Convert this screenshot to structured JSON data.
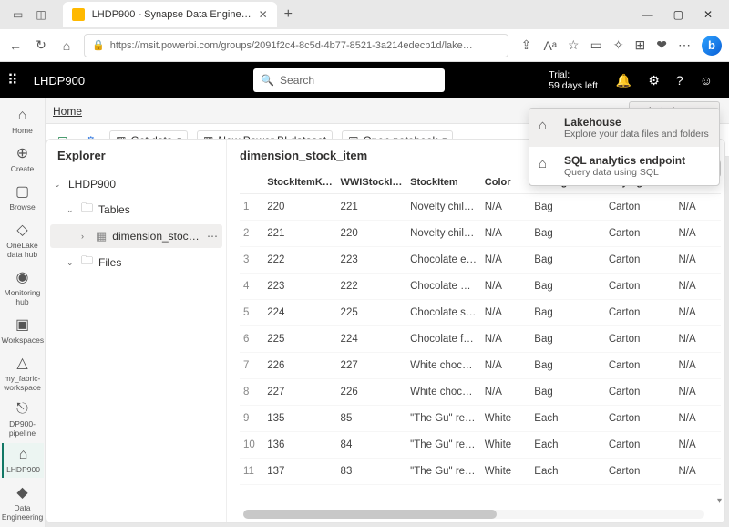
{
  "browser": {
    "tab_title": "LHDP900 - Synapse Data Engine…",
    "url": "https://msit.powerbi.com/groups/2091f2c4-8c5d-4b77-8521-3a214edecb1d/lake…"
  },
  "app": {
    "title": "LHDP900",
    "search_placeholder": "Search",
    "trial_label": "Trial:",
    "trial_days": "59 days left"
  },
  "breadcrumb": {
    "home": "Home"
  },
  "lakehouse_dropdown": {
    "label": "Lakehouse",
    "options": [
      {
        "title": "Lakehouse",
        "desc": "Explore your data files and folders"
      },
      {
        "title": "SQL analytics endpoint",
        "desc": "Query data using SQL"
      }
    ]
  },
  "toolbar": {
    "get_data": "Get data",
    "new_pbi": "New Power BI dataset",
    "open_notebook": "Open notebook"
  },
  "leftrail": [
    {
      "icon": "⌂",
      "label": "Home"
    },
    {
      "icon": "⊕",
      "label": "Create"
    },
    {
      "icon": "▢",
      "label": "Browse"
    },
    {
      "icon": "◇",
      "label": "OneLake data hub"
    },
    {
      "icon": "◉",
      "label": "Monitoring hub"
    },
    {
      "icon": "▣",
      "label": "Workspaces"
    },
    {
      "icon": "△",
      "label": "my_fabric-workspace"
    },
    {
      "icon": "⎋",
      "label": "DP900-pipeline"
    },
    {
      "icon": "⌂",
      "label": "LHDP900"
    },
    {
      "icon": "◆",
      "label": "Data Engineering"
    }
  ],
  "explorer": {
    "title": "Explorer",
    "root": "LHDP900",
    "tables": "Tables",
    "table_item": "dimension_stock_it…",
    "files": "Files"
  },
  "table": {
    "title": "dimension_stock_item",
    "columns": [
      "",
      "StockItemK…",
      "WWIStockI…",
      "StockItem",
      "Color",
      "SellingPack…",
      "BuyingPac…",
      "Brand"
    ],
    "rows": [
      [
        "1",
        "220",
        "221",
        "Novelty chil…",
        "N/A",
        "Bag",
        "Carton",
        "N/A"
      ],
      [
        "2",
        "221",
        "220",
        "Novelty chil…",
        "N/A",
        "Bag",
        "Carton",
        "N/A"
      ],
      [
        "3",
        "222",
        "223",
        "Chocolate e…",
        "N/A",
        "Bag",
        "Carton",
        "N/A"
      ],
      [
        "4",
        "223",
        "222",
        "Chocolate …",
        "N/A",
        "Bag",
        "Carton",
        "N/A"
      ],
      [
        "5",
        "224",
        "225",
        "Chocolate s…",
        "N/A",
        "Bag",
        "Carton",
        "N/A"
      ],
      [
        "6",
        "225",
        "224",
        "Chocolate f…",
        "N/A",
        "Bag",
        "Carton",
        "N/A"
      ],
      [
        "7",
        "226",
        "227",
        "White choc…",
        "N/A",
        "Bag",
        "Carton",
        "N/A"
      ],
      [
        "8",
        "227",
        "226",
        "White choc…",
        "N/A",
        "Bag",
        "Carton",
        "N/A"
      ],
      [
        "9",
        "135",
        "85",
        "\"The Gu\" re…",
        "White",
        "Each",
        "Carton",
        "N/A"
      ],
      [
        "10",
        "136",
        "84",
        "\"The Gu\" re…",
        "White",
        "Each",
        "Carton",
        "N/A"
      ],
      [
        "11",
        "137",
        "83",
        "\"The Gu\" re…",
        "White",
        "Each",
        "Carton",
        "N/A"
      ]
    ]
  }
}
